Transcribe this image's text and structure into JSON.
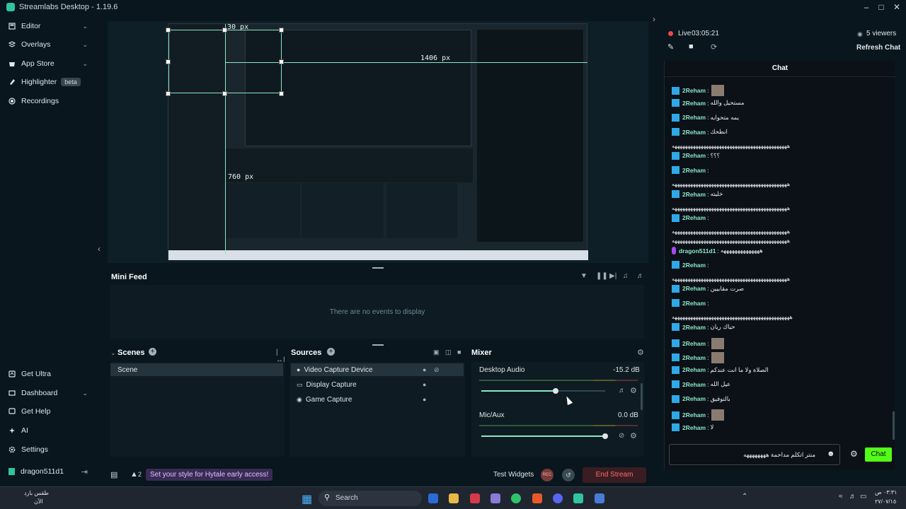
{
  "window": {
    "title": "Streamlabs Desktop - 1.19.6"
  },
  "nav": {
    "items": [
      {
        "label": "Editor",
        "icon": "editor-icon",
        "chevron": true
      },
      {
        "label": "Overlays",
        "icon": "overlays-icon",
        "chevron": true
      },
      {
        "label": "App Store",
        "icon": "app-store-icon",
        "chevron": true
      },
      {
        "label": "Highlighter",
        "icon": "highlighter-icon",
        "badge": "beta"
      },
      {
        "label": "Recordings",
        "icon": "recordings-icon"
      }
    ],
    "bottom": [
      {
        "label": "Get Ultra",
        "icon": "ultra-icon"
      },
      {
        "label": "Dashboard",
        "icon": "dashboard-icon",
        "chevron": true
      },
      {
        "label": "Get Help",
        "icon": "help-icon"
      },
      {
        "label": "AI",
        "icon": "ai-icon"
      },
      {
        "label": "Settings",
        "icon": "settings-icon"
      }
    ],
    "user": "dragon511d1"
  },
  "preview": {
    "labels": {
      "top": "30 px",
      "right": "1406 px",
      "bottom": "760 px"
    }
  },
  "minifeed": {
    "title": "Mini Feed",
    "empty": "There are no events to display"
  },
  "scenes": {
    "title": "Scenes",
    "items": [
      "Scene"
    ]
  },
  "sources": {
    "title": "Sources",
    "items": [
      "Video Capture Device",
      "Display Capture",
      "Game Capture"
    ]
  },
  "mixer": {
    "title": "Mixer",
    "channels": [
      {
        "name": "Desktop Audio",
        "db": "-15.2 dB",
        "level": 0.6
      },
      {
        "name": "Mic/Aux",
        "db": "0.0 dB",
        "level": 1.0
      }
    ]
  },
  "footer": {
    "alerts_count": "2",
    "promo": "Set your style for Hytale early access!",
    "test_widgets": "Test Widgets",
    "rec": "REC",
    "end_stream": "End Stream"
  },
  "chat": {
    "live_label": "Live",
    "live_time": "03:05:21",
    "viewers": "5 viewers",
    "refresh": "Refresh Chat",
    "title": "Chat",
    "messages": [
      {
        "user": "2Reham",
        "text": "",
        "thumb": true
      },
      {
        "user": "2Reham",
        "text": "مستحيل والله"
      },
      {
        "user": "2Reham",
        "text": "يمه متحوابه"
      },
      {
        "user": "2Reham",
        "text": "انطحك"
      },
      {
        "line": "ههههههههههههههههههههههههههههههههههههههههههههه"
      },
      {
        "user": "2Reham",
        "text": "؟؟؟"
      },
      {
        "user": "2Reham",
        "text": ""
      },
      {
        "line": "ههههههههههههههههههههههههههههههههههههههههههههه"
      },
      {
        "user": "2Reham",
        "text": "خليته"
      },
      {
        "line": "ههههههههههههههههههههههههههههههههههههههههههههه"
      },
      {
        "user": "2Reham",
        "text": ""
      },
      {
        "line": "ههههههههههههههههههههههههههههههههههههههههههههه"
      },
      {
        "line": "ههههههههههههههههههههههههههههههههههههههههههههه"
      },
      {
        "user": "dragon511d1",
        "text": "ههههههههههههههه",
        "purple": true
      },
      {
        "user": "2Reham",
        "text": ""
      },
      {
        "line": "ههههههههههههههههههههههههههههههههههههههههههههه"
      },
      {
        "user": "2Reham",
        "text": "صرت مقابيين"
      },
      {
        "user": "2Reham",
        "text": ""
      },
      {
        "line": "هههههههههههههههههههههههههههههههههههههههههههههه"
      },
      {
        "user": "2Reham",
        "text": "حياك ريان"
      },
      {
        "user": "2Reham",
        "text": "",
        "thumb": true
      },
      {
        "user": "2Reham",
        "text": "",
        "thumb": true
      },
      {
        "user": "2Reham",
        "text": "الصلاة ولا ما انت عندكم"
      },
      {
        "user": "2Reham",
        "text": "عيل الله"
      },
      {
        "user": "2Reham",
        "text": "بالتوفيق"
      },
      {
        "user": "2Reham",
        "text": "",
        "thumb": true
      },
      {
        "user": "2Reham",
        "text": "لا"
      }
    ],
    "input_value": "منتر اتكلم مداحمة ههههههههه",
    "send": "Chat"
  },
  "taskbar": {
    "weather": "طقس بارد",
    "weather_sub": "الآن",
    "search": "Search",
    "time": "٠٣:٣١ ص",
    "date": "٢٧/٠٧/١٥"
  }
}
